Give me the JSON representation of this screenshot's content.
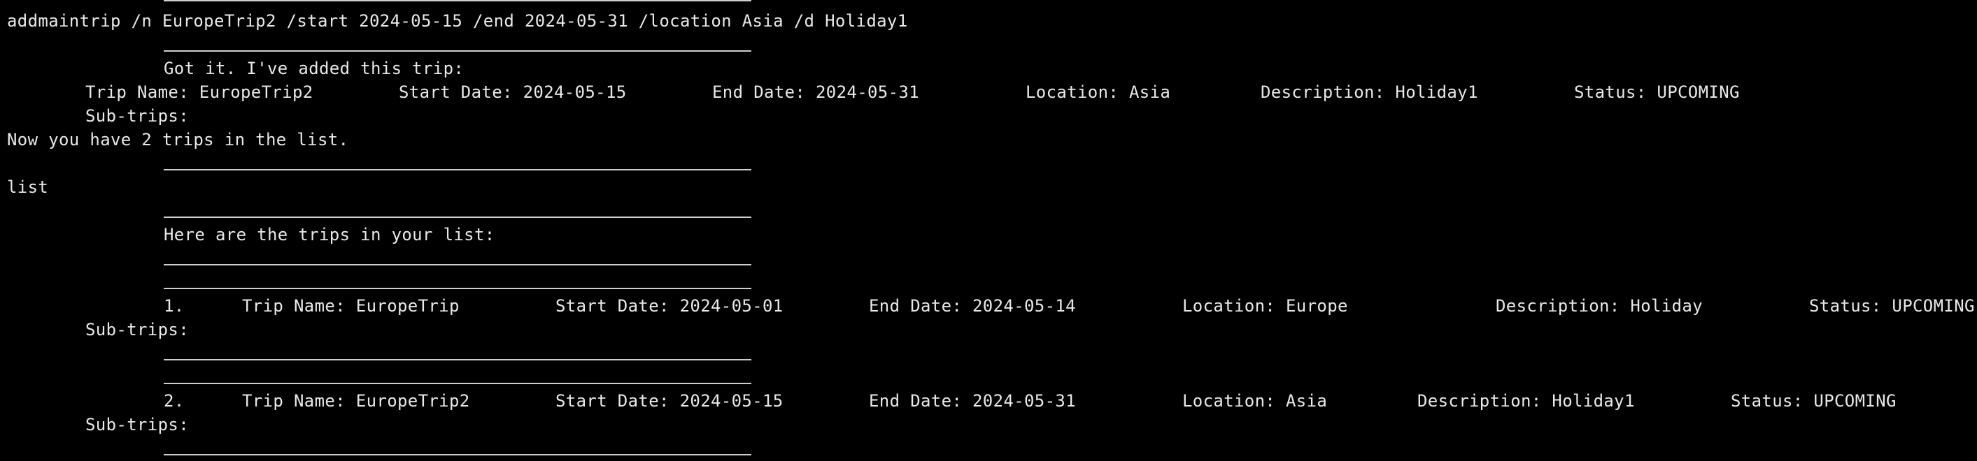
{
  "terminal": {
    "command_add": "addmaintrip /n EuropeTrip2 /start 2024-05-15 /end 2024-05-31 /location Asia /d Holiday1",
    "ack": "Got it. I've added this trip:",
    "added_trip": {
      "name": "Trip Name: EuropeTrip2",
      "start": "Start Date: 2024-05-15",
      "end": "End Date: 2024-05-31",
      "location": "Location: Asia",
      "description": "Description: Holiday1",
      "status": "Status: UPCOMING",
      "subtrips": "Sub-trips:"
    },
    "count_msg": "Now you have 2 trips in the list.",
    "command_list": "list",
    "list_header": "Here are the trips in your list:",
    "trips": [
      {
        "index": "1.",
        "name": "Trip Name: EuropeTrip",
        "start": "Start Date: 2024-05-01",
        "end": "End Date: 2024-05-14",
        "location": "Location: Europe",
        "description": "Description: Holiday",
        "status": "Status: UPCOMING",
        "subtrips": "Sub-trips:"
      },
      {
        "index": "2.",
        "name": "Trip Name: EuropeTrip2",
        "start": "Start Date: 2024-05-15",
        "end": "End Date: 2024-05-31",
        "location": "Location: Asia",
        "description": "Description: Holiday1",
        "status": "Status: UPCOMING",
        "subtrips": "Sub-trips:"
      }
    ]
  }
}
